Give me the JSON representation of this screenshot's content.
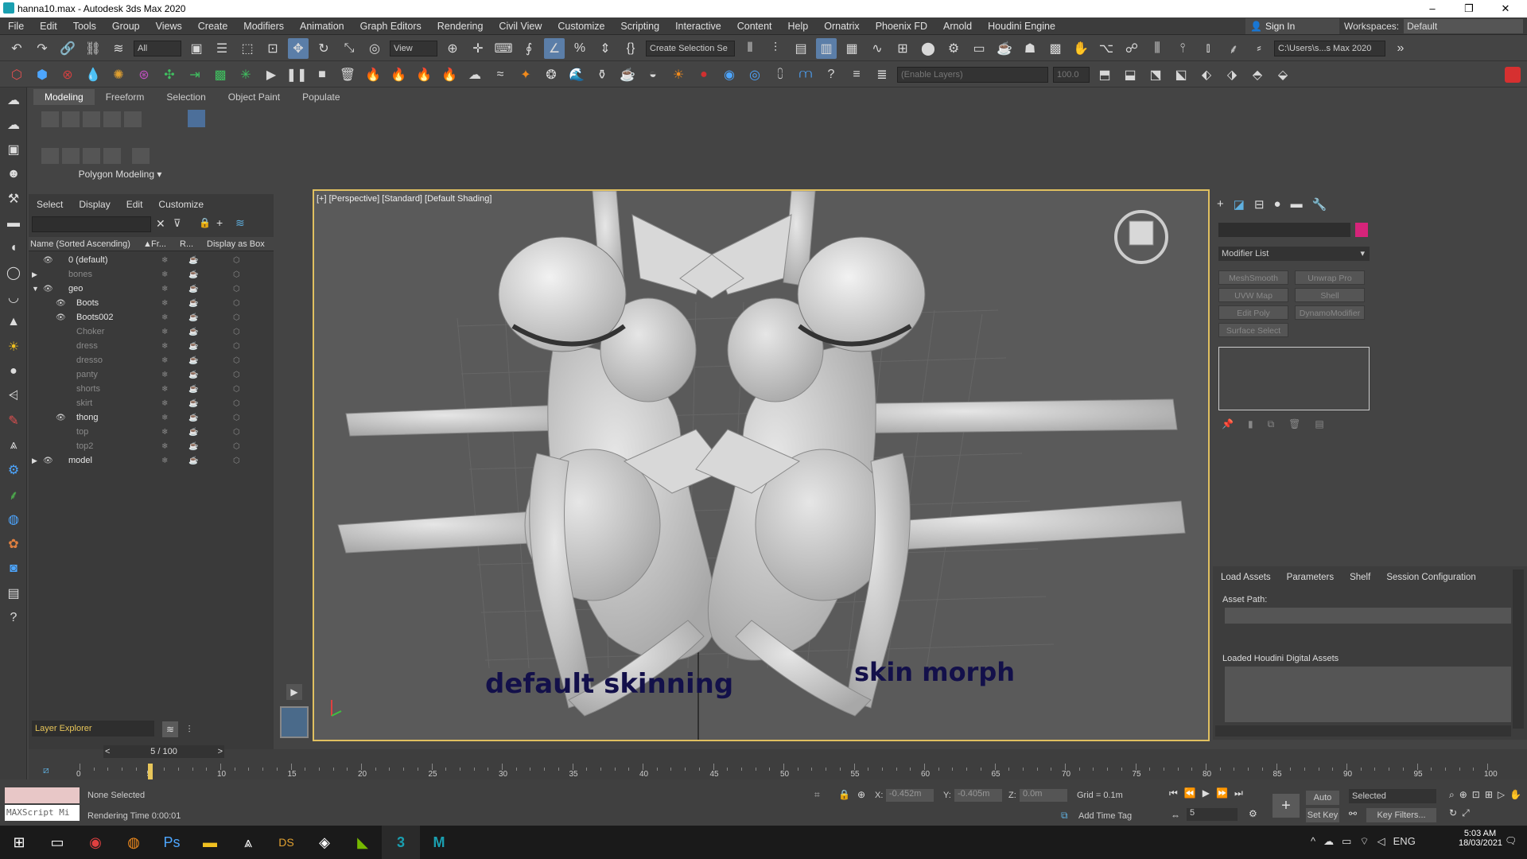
{
  "window": {
    "title": "hanna10.max - Autodesk 3ds Max 2020",
    "minimize": "–",
    "restore": "❐",
    "close": "✕"
  },
  "menu": [
    "File",
    "Edit",
    "Tools",
    "Group",
    "Views",
    "Create",
    "Modifiers",
    "Animation",
    "Graph Editors",
    "Rendering",
    "Civil View",
    "Customize",
    "Scripting",
    "Interactive",
    "Content",
    "Help",
    "Ornatrix",
    "Phoenix FD",
    "Arnold",
    "Houdini Engine"
  ],
  "signin": {
    "label": "Sign In"
  },
  "workspaces": {
    "label": "Workspaces:",
    "value": "Default"
  },
  "toolbar1": {
    "selection_filter": "All",
    "ref_coord": "View",
    "named_selection": "Create Selection Se",
    "project_path": "C:\\Users\\s...s Max 2020"
  },
  "toolbar2": {
    "layers": "(Enable Layers)",
    "value": "100.0"
  },
  "ribbon": {
    "tabs": [
      "Modeling",
      "Freeform",
      "Selection",
      "Object Paint",
      "Populate"
    ],
    "panel": "Polygon Modeling"
  },
  "scene_explorer": {
    "menu": [
      "Select",
      "Display",
      "Edit",
      "Customize"
    ],
    "columns": {
      "name": "Name (Sorted Ascending)",
      "fr": "Fr...",
      "r": "R...",
      "box": "Display as Box"
    },
    "rows": [
      {
        "name": "0 (default)",
        "level": 0,
        "visible": true
      },
      {
        "name": "bones",
        "level": 0,
        "visible": false
      },
      {
        "name": "geo",
        "level": 0,
        "visible": true
      },
      {
        "name": "Boots",
        "level": 1,
        "visible": true
      },
      {
        "name": "Boots002",
        "level": 1,
        "visible": true
      },
      {
        "name": "Choker",
        "level": 1,
        "visible": false
      },
      {
        "name": "dress",
        "level": 1,
        "visible": false
      },
      {
        "name": "dresso",
        "level": 1,
        "visible": false
      },
      {
        "name": "panty",
        "level": 1,
        "visible": false
      },
      {
        "name": "shorts",
        "level": 1,
        "visible": false
      },
      {
        "name": "skirt",
        "level": 1,
        "visible": false
      },
      {
        "name": "thong",
        "level": 1,
        "visible": true
      },
      {
        "name": "top",
        "level": 1,
        "visible": false
      },
      {
        "name": "top2",
        "level": 1,
        "visible": false
      },
      {
        "name": "model",
        "level": 0,
        "visible": true
      }
    ],
    "layer_explorer": "Layer Explorer"
  },
  "viewport": {
    "label": "[+] [Perspective] [Standard] [Default Shading]",
    "left_caption": "default skinning",
    "right_caption": "skin morph"
  },
  "command_panel": {
    "modifier_list": "Modifier List",
    "buttons": [
      "MeshSmooth",
      "Unwrap Pro",
      "UVW Map",
      "Shell",
      "Edit Poly",
      "DynamoModifier",
      "Surface Select"
    ]
  },
  "houdini": {
    "tabs": [
      "Load Assets",
      "Parameters",
      "Shelf",
      "Session Configuration"
    ],
    "asset_path": "Asset Path:",
    "loaded": "Loaded Houdini Digital Assets"
  },
  "timeline": {
    "frame": "5 / 100",
    "ticks": [
      "0",
      "5",
      "10",
      "15",
      "20",
      "25",
      "30",
      "35",
      "40",
      "45",
      "50",
      "55",
      "60",
      "65",
      "70",
      "75",
      "80",
      "85",
      "90",
      "95",
      "100"
    ]
  },
  "status": {
    "selection": "None Selected",
    "render_time": "Rendering Time  0:00:01",
    "maxscript": "MAXScript Mi",
    "x_label": "X:",
    "x": "-0.452m",
    "y_label": "Y:",
    "y": "-0.405m",
    "z_label": "Z:",
    "z": "0.0m",
    "grid": "Grid = 0.1m",
    "add_time_tag": "Add Time Tag",
    "auto_key": "Auto Key",
    "selected": "Selected",
    "set_key": "Set Key",
    "key_filters": "Key Filters...",
    "frame_field": "5"
  },
  "taskbar": {
    "lang": "ENG",
    "time": "5:03 AM",
    "date": "18/03/2021"
  }
}
